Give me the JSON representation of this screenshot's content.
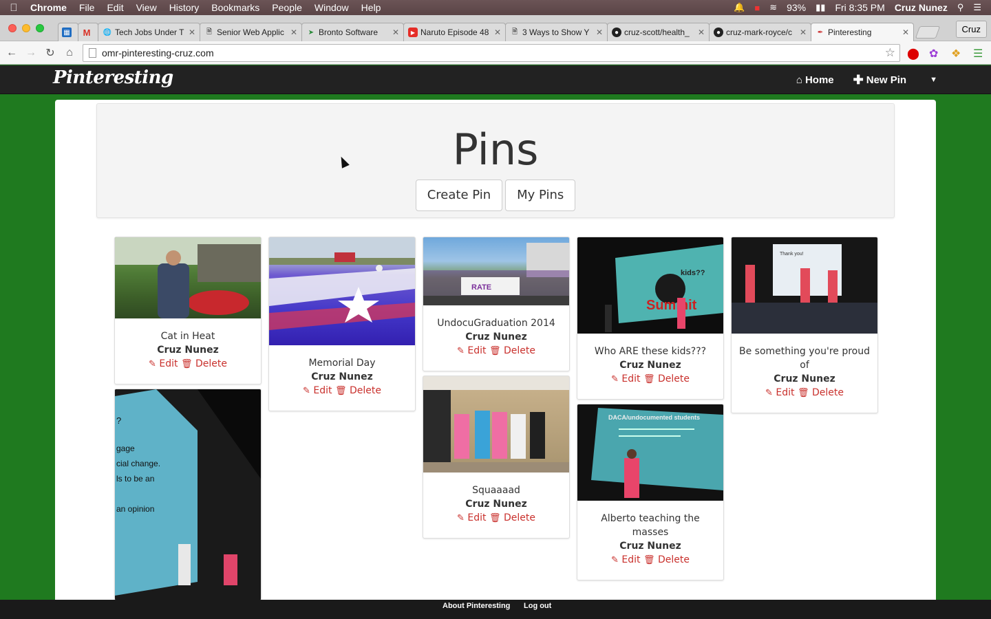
{
  "menubar": {
    "app": "Chrome",
    "items": [
      "File",
      "Edit",
      "View",
      "History",
      "Bookmarks",
      "People",
      "Window",
      "Help"
    ],
    "battery": "93%",
    "clock": "Fri 8:35 PM",
    "user": "Cruz Nunez"
  },
  "tabs": [
    {
      "title": "Tech Jobs Under T",
      "icon": "globe-icon"
    },
    {
      "title": "Senior Web Applic",
      "icon": "page-icon"
    },
    {
      "title": "Bronto Software",
      "icon": "bronto-icon"
    },
    {
      "title": "Naruto Episode 48",
      "icon": "youtube-icon"
    },
    {
      "title": "3 Ways to Show Y",
      "icon": "page-icon"
    },
    {
      "title": "cruz-scott/health_",
      "icon": "github-icon"
    },
    {
      "title": "cruz-mark-royce/c",
      "icon": "github-icon"
    },
    {
      "title": "Pinteresting",
      "icon": "pin-icon"
    }
  ],
  "profile_button": "Cruz",
  "url": "omr-pinteresting-cruz.com",
  "site": {
    "brand": "Pinteresting",
    "nav": {
      "home": "Home",
      "new_pin": "New Pin"
    }
  },
  "header": {
    "title": "Pins",
    "create_pin": "Create Pin",
    "my_pins": "My Pins"
  },
  "pins": [
    {
      "title": "Cat in Heat",
      "author": "Cruz Nunez"
    },
    {
      "title": "Memorial Day",
      "author": "Cruz Nunez"
    },
    {
      "title": "UndocuGraduation 2014",
      "author": "Cruz Nunez"
    },
    {
      "title": "Who ARE these kids???",
      "author": "Cruz Nunez"
    },
    {
      "title": "Be something you're proud of",
      "author": "Cruz Nunez"
    },
    {
      "title": "Squaaaad",
      "author": "Cruz Nunez"
    },
    {
      "title": "Alberto teaching the masses",
      "author": "Cruz Nunez"
    },
    {
      "title": "",
      "author": ""
    }
  ],
  "actions": {
    "edit": "Edit",
    "delete": "Delete"
  },
  "footer": {
    "about": "About Pinteresting",
    "logout": "Log out"
  },
  "colors": {
    "page_bg": "#1f7a1f",
    "navbar": "#222222",
    "danger": "#c9302c"
  }
}
